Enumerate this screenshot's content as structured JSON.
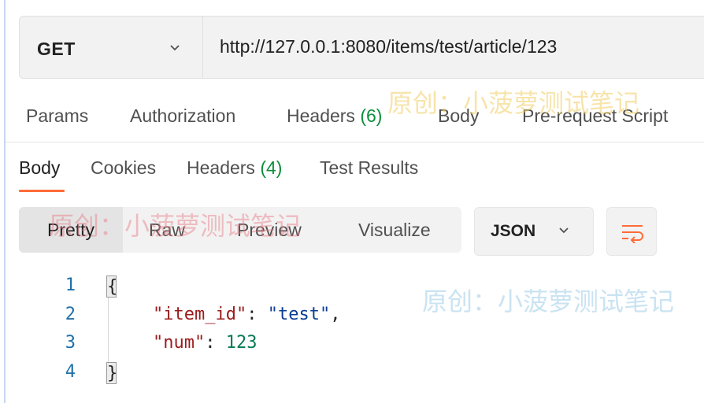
{
  "request": {
    "method": "GET",
    "url": "http://127.0.0.1:8080/items/test/article/123"
  },
  "request_tabs": [
    {
      "label": "Params"
    },
    {
      "label": "Authorization"
    },
    {
      "label": "Headers",
      "count": "(6)"
    },
    {
      "label": "Body"
    },
    {
      "label": "Pre-request Script"
    }
  ],
  "response_tabs": [
    {
      "label": "Body",
      "active": true
    },
    {
      "label": "Cookies"
    },
    {
      "label": "Headers",
      "count": "(4)"
    },
    {
      "label": "Test Results"
    }
  ],
  "view_options": [
    "Pretty",
    "Raw",
    "Preview",
    "Visualize"
  ],
  "active_view": "Pretty",
  "format": "JSON",
  "wrap_icon": "wrap-lines-icon",
  "code": {
    "line_numbers": [
      "1",
      "2",
      "3",
      "4"
    ],
    "open_brace": "{",
    "close_brace": "}",
    "key1": "\"item_id\"",
    "sep1": ": ",
    "val1": "\"test\"",
    "comma": ",",
    "key2": "\"num\"",
    "sep2": ": ",
    "val2": "123"
  },
  "watermark": "原创：小菠萝测试笔记",
  "colors": {
    "accent": "#ff6c37",
    "count_green": "#0d8f3b",
    "json_key": "#9b1c1c",
    "json_string": "#0b3d91",
    "json_number": "#0a7a53"
  }
}
